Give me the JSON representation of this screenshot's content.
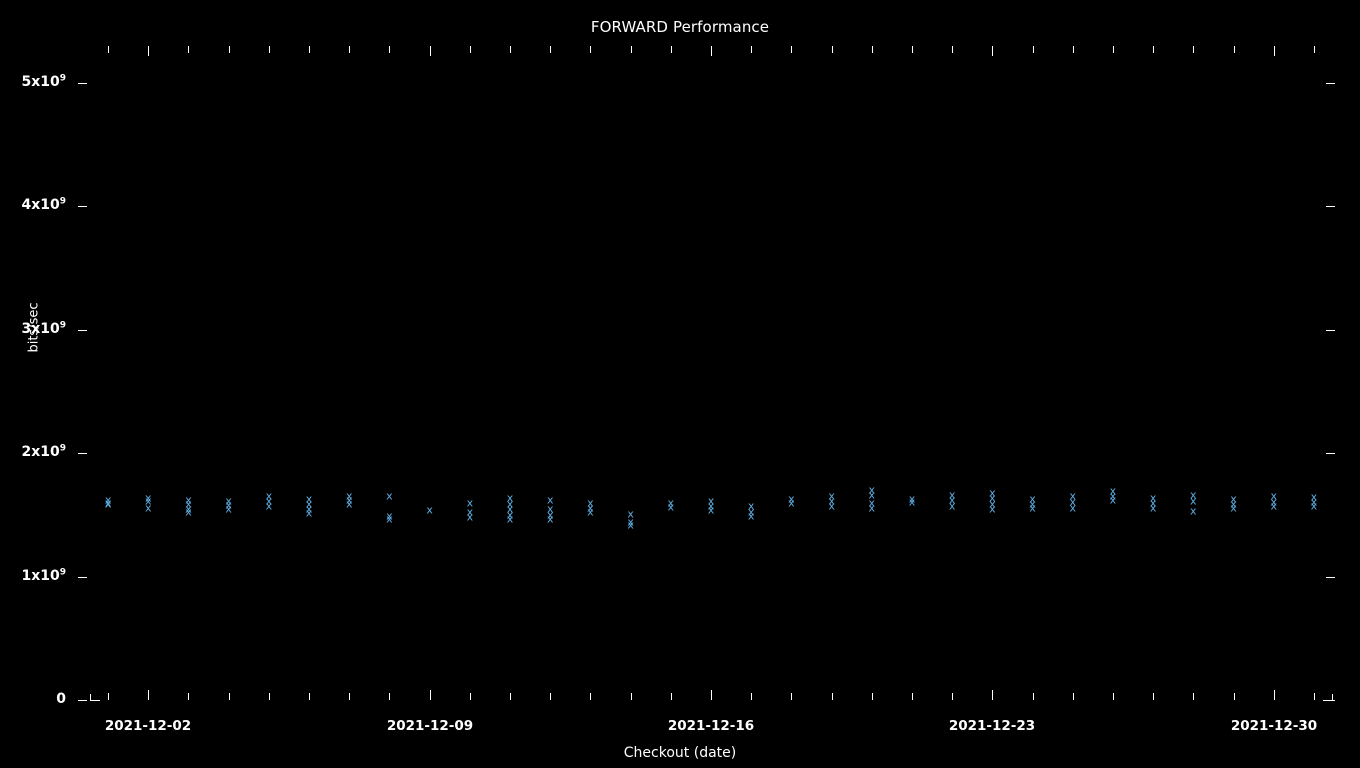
{
  "chart_data": {
    "type": "scatter",
    "title": "FORWARD Performance",
    "xlabel": "Checkout (date)",
    "ylabel": "bits/sec",
    "grid": false,
    "legend": null,
    "marker": "x",
    "marker_color": "#5dade2",
    "background_color": "#000000",
    "foreground_color": "#ffffff",
    "ylim": [
      0,
      5300000000
    ],
    "yticks": [
      0,
      1000000000,
      2000000000,
      3000000000,
      4000000000,
      5000000000
    ],
    "ytick_labels": [
      "0",
      "1x10⁹",
      "2x10⁹",
      "3x10⁹",
      "4x10⁹",
      "5x10⁹"
    ],
    "ytick_labels_html": [
      "0",
      "1x10<sup>9</sup>",
      "2x10<sup>9</sup>",
      "3x10<sup>9</sup>",
      "4x10<sup>9</sup>",
      "5x10<sup>9</sup>"
    ],
    "xlim": [
      "2021-12-01",
      "2021-12-31"
    ],
    "xticks": [
      "2021-12-02",
      "2021-12-09",
      "2021-12-16",
      "2021-12-23",
      "2021-12-30"
    ],
    "xtick_labels": [
      "2021-12-02",
      "2021-12-09",
      "2021-12-16",
      "2021-12-23",
      "2021-12-30"
    ],
    "x_minor_tick_count": 31,
    "series": [
      {
        "name": "FORWARD",
        "points": [
          {
            "x": "2021-12-01",
            "values": [
              1620000000,
              1600000000,
              1585000000
            ]
          },
          {
            "x": "2021-12-02",
            "values": [
              1640000000,
              1610000000,
              1560000000
            ]
          },
          {
            "x": "2021-12-03",
            "values": [
              1620000000,
              1585000000,
              1545000000,
              1520000000
            ]
          },
          {
            "x": "2021-12-04",
            "values": [
              1615000000,
              1580000000,
              1545000000
            ]
          },
          {
            "x": "2021-12-05",
            "values": [
              1650000000,
              1610000000,
              1570000000
            ]
          },
          {
            "x": "2021-12-06",
            "values": [
              1630000000,
              1590000000,
              1545000000,
              1515000000
            ]
          },
          {
            "x": "2021-12-07",
            "values": [
              1655000000,
              1620000000,
              1585000000
            ]
          },
          {
            "x": "2021-12-08",
            "values": [
              1655000000,
              1490000000,
              1465000000
            ]
          },
          {
            "x": "2021-12-09",
            "values": [
              1540000000
            ]
          },
          {
            "x": "2021-12-10",
            "values": [
              1600000000,
              1520000000,
              1480000000
            ]
          },
          {
            "x": "2021-12-11",
            "values": [
              1635000000,
              1590000000,
              1545000000,
              1500000000,
              1470000000
            ]
          },
          {
            "x": "2021-12-12",
            "values": [
              1620000000,
              1545000000,
              1500000000,
              1470000000
            ]
          },
          {
            "x": "2021-12-13",
            "values": [
              1600000000,
              1560000000,
              1525000000
            ]
          },
          {
            "x": "2021-12-14",
            "values": [
              1510000000,
              1445000000,
              1420000000
            ]
          },
          {
            "x": "2021-12-15",
            "values": [
              1600000000,
              1565000000
            ]
          },
          {
            "x": "2021-12-16",
            "values": [
              1615000000,
              1575000000,
              1540000000
            ]
          },
          {
            "x": "2021-12-17",
            "values": [
              1575000000,
              1525000000,
              1495000000
            ]
          },
          {
            "x": "2021-12-18",
            "values": [
              1630000000,
              1600000000
            ]
          },
          {
            "x": "2021-12-19",
            "values": [
              1650000000,
              1610000000,
              1575000000
            ]
          },
          {
            "x": "2021-12-20",
            "values": [
              1700000000,
              1660000000,
              1600000000,
              1560000000
            ]
          },
          {
            "x": "2021-12-21",
            "values": [
              1630000000,
              1605000000
            ]
          },
          {
            "x": "2021-12-22",
            "values": [
              1660000000,
              1620000000,
              1575000000
            ]
          },
          {
            "x": "2021-12-23",
            "values": [
              1680000000,
              1640000000,
              1585000000,
              1545000000
            ]
          },
          {
            "x": "2021-12-24",
            "values": [
              1625000000,
              1590000000,
              1555000000
            ]
          },
          {
            "x": "2021-12-25",
            "values": [
              1650000000,
              1605000000,
              1560000000
            ]
          },
          {
            "x": "2021-12-26",
            "values": [
              1695000000,
              1655000000,
              1620000000
            ]
          },
          {
            "x": "2021-12-27",
            "values": [
              1640000000,
              1595000000,
              1560000000
            ]
          },
          {
            "x": "2021-12-28",
            "values": [
              1660000000,
              1615000000,
              1530000000
            ]
          },
          {
            "x": "2021-12-29",
            "values": [
              1625000000,
              1590000000,
              1560000000
            ]
          },
          {
            "x": "2021-12-30",
            "values": [
              1650000000,
              1605000000,
              1570000000
            ]
          },
          {
            "x": "2021-12-31",
            "values": [
              1645000000,
              1605000000,
              1575000000
            ]
          }
        ]
      }
    ]
  }
}
